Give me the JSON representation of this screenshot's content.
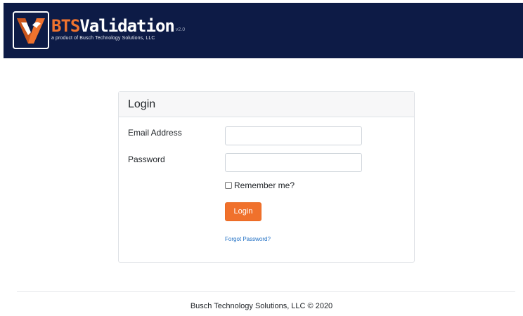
{
  "header": {
    "logo": {
      "icon": "bts-v-logo-icon",
      "brand_accent": "BTS",
      "brand_name": "Validation",
      "version": "v2.0",
      "tagline": "a product of Busch Technology Solutions, LLC"
    },
    "colors": {
      "background": "#0d1b46",
      "accent": "#f0732e"
    }
  },
  "login_card": {
    "title": "Login",
    "email": {
      "label": "Email Address",
      "value": "",
      "placeholder": ""
    },
    "password": {
      "label": "Password",
      "value": "",
      "placeholder": ""
    },
    "remember_me": {
      "label": "Remember me?",
      "checked": false
    },
    "submit_label": "Login",
    "forgot_link": "Forgot Password?",
    "colors": {
      "button": "#f0712c",
      "link": "#1f6fc4"
    }
  },
  "footer": {
    "text": "Busch Technology Solutions, LLC © 2020"
  }
}
